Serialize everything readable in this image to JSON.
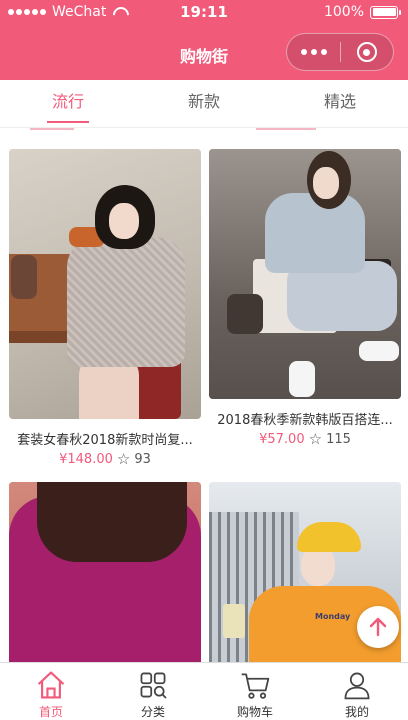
{
  "status_bar": {
    "carrier": "WeChat",
    "time": "19:11",
    "battery": "100%",
    "battery_level": 1.0
  },
  "nav": {
    "title": "购物街"
  },
  "tabs": [
    {
      "label": "流行",
      "active": true
    },
    {
      "label": "新款",
      "active": false
    },
    {
      "label": "精选",
      "active": false
    }
  ],
  "products": [
    {
      "title": "套装女春秋2018新款时尚复...",
      "price": "¥148.00",
      "likes": "93"
    },
    {
      "title": "2018春秋季新款韩版百搭连...",
      "price": "¥57.00",
      "likes": "115"
    },
    {
      "title": "",
      "price": "",
      "likes": ""
    },
    {
      "title": "",
      "price": "",
      "likes": ""
    }
  ],
  "shirt_text": "Monday",
  "tabbar": [
    {
      "label": "首页",
      "icon": "home-icon",
      "active": true
    },
    {
      "label": "分类",
      "icon": "category-icon",
      "active": false
    },
    {
      "label": "购物车",
      "icon": "cart-icon",
      "active": false
    },
    {
      "label": "我的",
      "icon": "profile-icon",
      "active": false
    }
  ],
  "colors": {
    "accent": "#f25a7a",
    "text": "#333333",
    "muted": "#666666"
  }
}
